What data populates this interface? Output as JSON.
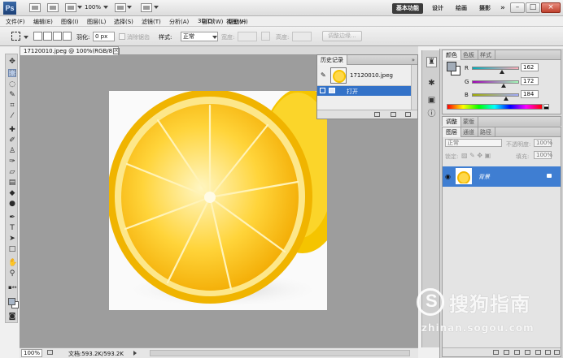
{
  "app": {
    "logo": "Ps",
    "zoom": "100%",
    "workspaces": [
      "基本功能",
      "设计",
      "绘画",
      "摄影"
    ],
    "more": "»"
  },
  "menu": [
    "文件(F)",
    "编辑(E)",
    "图像(I)",
    "图层(L)",
    "选择(S)",
    "滤镜(T)",
    "分析(A)",
    "3D(D)",
    "视图(V)",
    "窗口(W)",
    "帮助(H)"
  ],
  "options": {
    "feather_label": "羽化:",
    "feather_value": "0 px",
    "antialias_label": "消除锯齿",
    "style_label": "样式:",
    "style_value": "正常",
    "width_label": "宽度:",
    "height_label": "高度:",
    "refine_edge": "调整边缘..."
  },
  "document": {
    "tab_title": "17120010.jpeg @ 100%(RGB/8)",
    "close": "×",
    "zoom": "100%",
    "doc_info": "文档:593.2K/593.2K"
  },
  "history": {
    "tabs": [
      "历史记录"
    ],
    "snapshot_name": "17120010.jpeg",
    "steps": [
      "打开"
    ],
    "menu": "»"
  },
  "color_panel": {
    "tabs": [
      "颜色",
      "色板",
      "样式"
    ],
    "channels": [
      {
        "label": "R",
        "value": "162",
        "level": 0.635
      },
      {
        "label": "G",
        "value": "172",
        "level": 0.675
      },
      {
        "label": "B",
        "value": "184",
        "level": 0.72
      }
    ],
    "foreground": "#a2acb8",
    "background": "#ffffff"
  },
  "adjust_panel": {
    "tabs": [
      "调整",
      "蒙版"
    ]
  },
  "layers_panel": {
    "tabs": [
      "图层",
      "通道",
      "路径"
    ],
    "blend_mode": "正常",
    "opacity_label": "不透明度:",
    "opacity_value": "100%",
    "lock_label": "锁定:",
    "fill_label": "填充:",
    "fill_value": "100%",
    "layers": [
      {
        "name": "背景",
        "visible": true,
        "locked": true
      }
    ]
  },
  "watermark": {
    "text": "搜狗指南",
    "url": "zhinan.sogou.com"
  },
  "colors": {
    "selection_blue": "#3372c8",
    "layer_blue": "#3f7ed2",
    "workspace_gray": "#9d9d9d"
  }
}
